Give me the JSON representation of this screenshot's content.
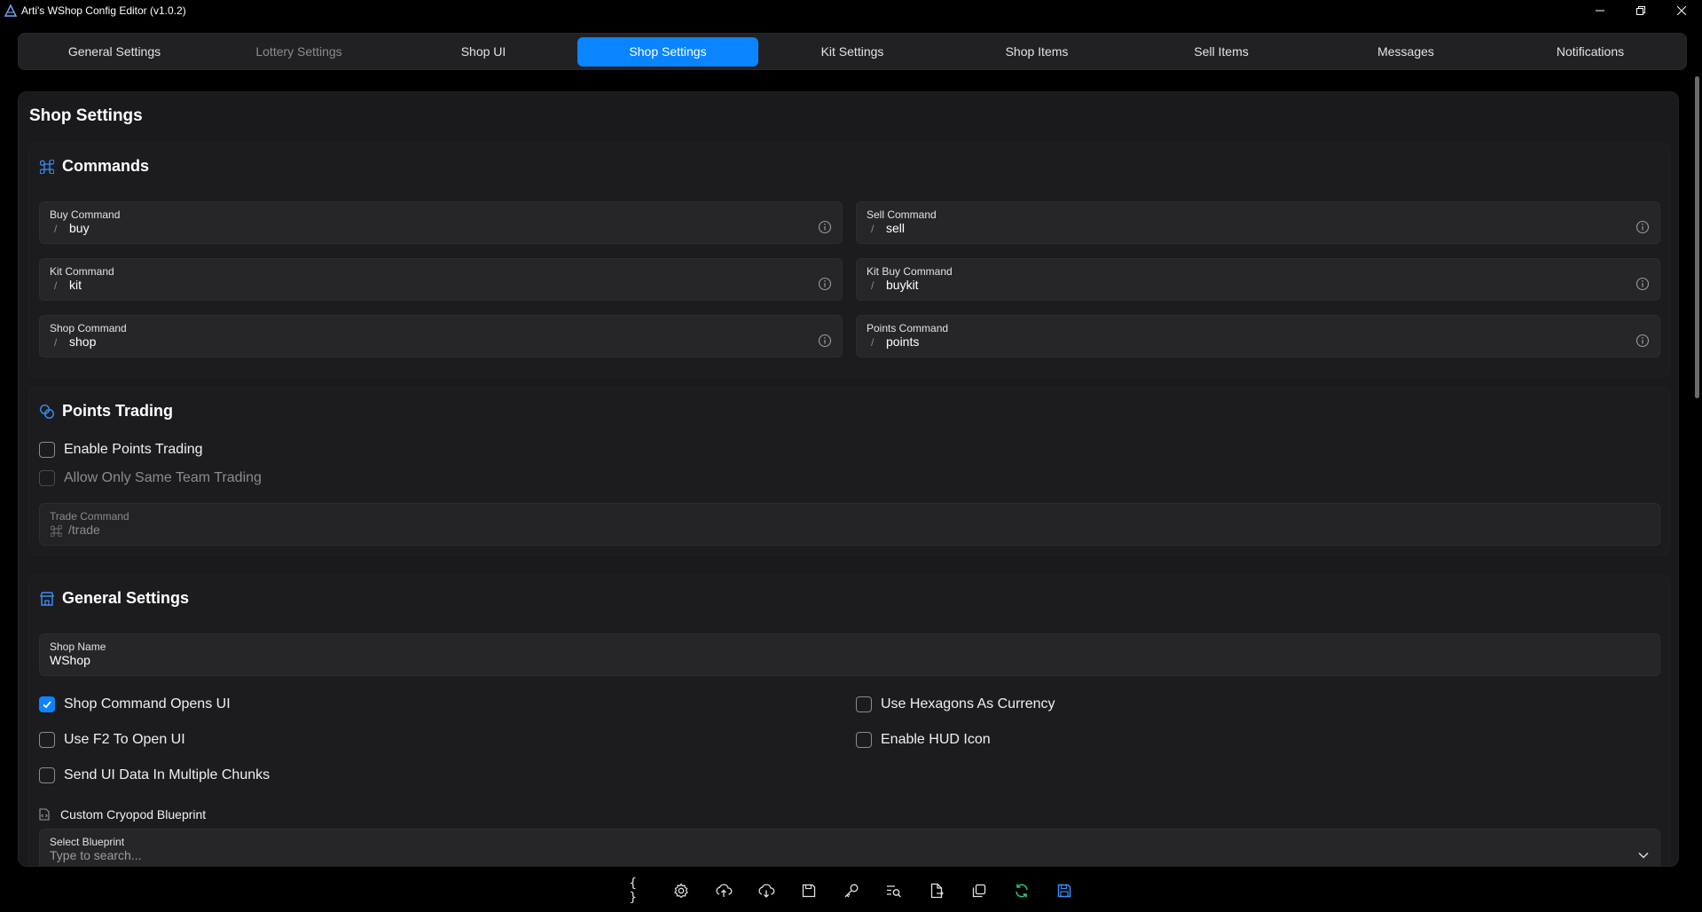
{
  "window": {
    "title": "Arti's WShop Config Editor (v1.0.2)"
  },
  "tabs": [
    {
      "label": "General Settings",
      "state": "normal"
    },
    {
      "label": "Lottery Settings",
      "state": "dim"
    },
    {
      "label": "Shop UI",
      "state": "normal"
    },
    {
      "label": "Shop Settings",
      "state": "active"
    },
    {
      "label": "Kit Settings",
      "state": "normal"
    },
    {
      "label": "Shop Items",
      "state": "normal"
    },
    {
      "label": "Sell Items",
      "state": "normal"
    },
    {
      "label": "Messages",
      "state": "normal"
    },
    {
      "label": "Notifications",
      "state": "normal"
    }
  ],
  "page": {
    "title": "Shop Settings"
  },
  "commands": {
    "title": "Commands",
    "prefix": "/",
    "fields": [
      {
        "label": "Buy Command",
        "value": "buy"
      },
      {
        "label": "Sell Command",
        "value": "sell"
      },
      {
        "label": "Kit Command",
        "value": "kit"
      },
      {
        "label": "Kit Buy Command",
        "value": "buykit"
      },
      {
        "label": "Shop Command",
        "value": "shop"
      },
      {
        "label": "Points Command",
        "value": "points"
      }
    ]
  },
  "points_trading": {
    "title": "Points Trading",
    "enable_label": "Enable Points Trading",
    "same_team_label": "Allow Only Same Team Trading",
    "trade_command": {
      "label": "Trade Command",
      "value": "/trade"
    }
  },
  "general": {
    "title": "General Settings",
    "shop_name": {
      "label": "Shop Name",
      "value": "WShop"
    },
    "options": [
      {
        "label": "Shop Command Opens UI",
        "checked": true
      },
      {
        "label": "Use Hexagons As Currency",
        "checked": false
      },
      {
        "label": "Use F2 To Open UI",
        "checked": false
      },
      {
        "label": "Enable HUD Icon",
        "checked": false
      },
      {
        "label": "Send UI Data In Multiple Chunks",
        "checked": false
      }
    ],
    "cryopod": {
      "label": "Custom Cryopod Blueprint",
      "select_label": "Select Blueprint",
      "placeholder": "Type to search..."
    }
  },
  "colors": {
    "accent": "#0a84ff",
    "panel": "#1a1a1d",
    "field": "#262629",
    "refresh": "#2ec27e"
  },
  "toolbar": {
    "icons": [
      "braces-icon",
      "gear-icon",
      "cloud-upload-icon",
      "cloud-download-icon",
      "floppy-icon",
      "key-icon",
      "search-list-icon",
      "file-export-icon",
      "copy-icon",
      "refresh-icon",
      "save-icon"
    ]
  }
}
